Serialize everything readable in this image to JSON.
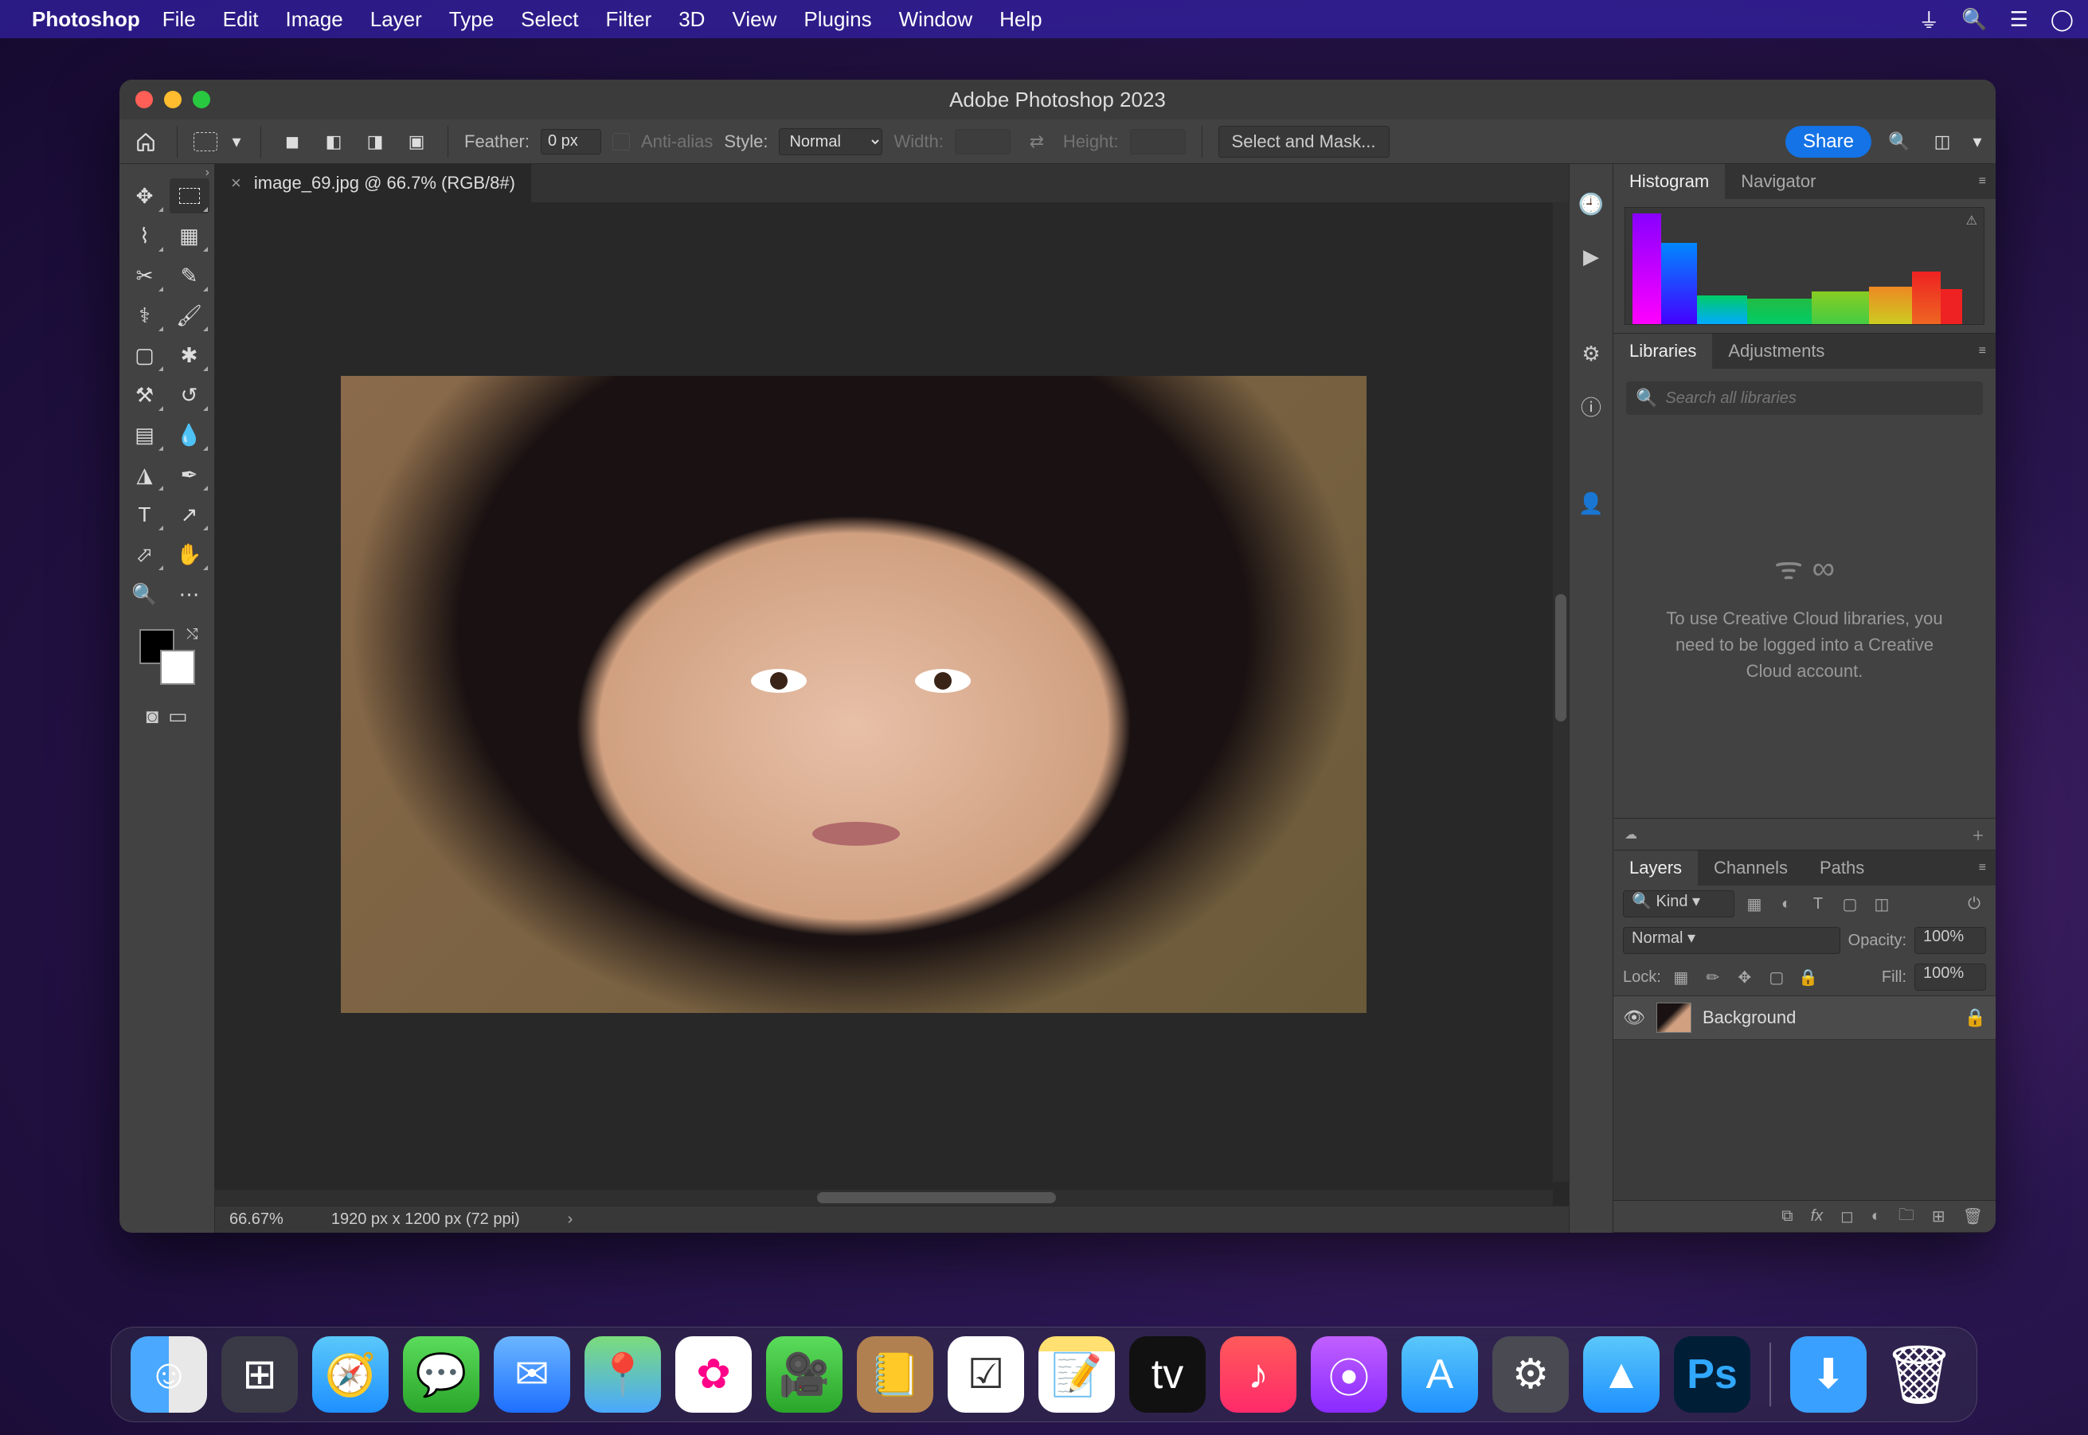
{
  "menubar": {
    "app": "Photoshop",
    "items": [
      "File",
      "Edit",
      "Image",
      "Layer",
      "Type",
      "Select",
      "Filter",
      "3D",
      "View",
      "Plugins",
      "Window",
      "Help"
    ]
  },
  "window": {
    "title": "Adobe Photoshop 2023"
  },
  "options": {
    "feather_label": "Feather:",
    "feather_value": "0 px",
    "antialias_label": "Anti-alias",
    "style_label": "Style:",
    "style_value": "Normal",
    "width_label": "Width:",
    "width_value": "",
    "height_label": "Height:",
    "height_value": "",
    "select_mask": "Select and Mask...",
    "share": "Share"
  },
  "document": {
    "tab": "image_69.jpg @ 66.7% (RGB/8#)",
    "zoom": "66.67%",
    "info": "1920 px x 1200 px (72 ppi)"
  },
  "panels": {
    "histogram": {
      "tabs": [
        "Histogram",
        "Navigator"
      ],
      "active": 0
    },
    "libraries": {
      "tabs": [
        "Libraries",
        "Adjustments"
      ],
      "active": 0,
      "search_placeholder": "Search all libraries",
      "message": "To use Creative Cloud libraries, you need to be logged into a Creative Cloud account."
    },
    "layers": {
      "tabs": [
        "Layers",
        "Channels",
        "Paths"
      ],
      "active": 0,
      "filter_label": "Kind",
      "blend_mode": "Normal",
      "opacity_label": "Opacity:",
      "opacity_value": "100%",
      "lock_label": "Lock:",
      "fill_label": "Fill:",
      "fill_value": "100%",
      "layer_name": "Background"
    }
  },
  "dock": {
    "apps": [
      "Finder",
      "Launchpad",
      "Safari",
      "Messages",
      "Mail",
      "Maps",
      "Photos",
      "FaceTime",
      "Contacts",
      "Reminders",
      "Notes",
      "TV",
      "Music",
      "Podcasts",
      "App Store",
      "System Settings",
      "Peaks",
      "Photoshop"
    ],
    "right": [
      "Downloads",
      "Trash"
    ]
  }
}
